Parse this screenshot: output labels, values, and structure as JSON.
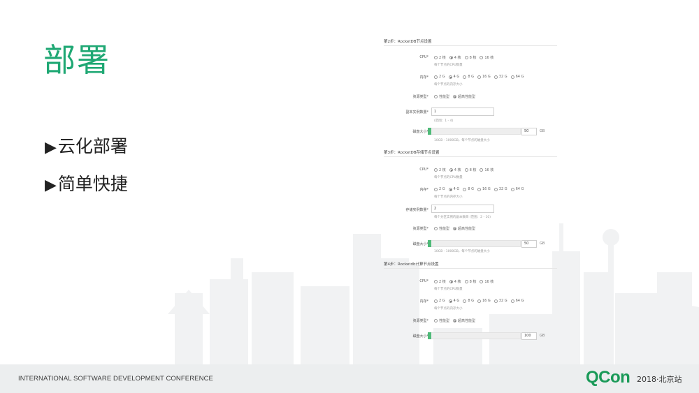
{
  "slide": {
    "title": "部署",
    "bullet_marker": "▶",
    "bullets": [
      "云化部署",
      "简单快捷"
    ]
  },
  "form": {
    "sections": [
      {
        "title": "第2步：RocketDB节点设置",
        "cpu_label": "CPU*",
        "cpu_options": [
          "2 核",
          "4 核",
          "8 核",
          "16 核"
        ],
        "cpu_selected": 1,
        "cpu_hint": "每个节点的CPU数量",
        "mem_label": "内存*",
        "mem_options": [
          "2 G",
          "4 G",
          "8 G",
          "16 G",
          "32 G",
          "64 G"
        ],
        "mem_selected": 1,
        "mem_hint": "每个节点的内存大小",
        "res_label": "资源类型*",
        "res_options": [
          "性能型",
          "超高性能型"
        ],
        "res_selected": 1,
        "replica_label": "副本实例数量*",
        "replica_value": "1",
        "replica_hint": "(范围：1 - 4)",
        "disk_label": "磁盘大小*",
        "disk_value": "50",
        "disk_fraction": 0.0,
        "disk_unit": "GB",
        "disk_hint": "10GB - 1000GB，每个节点的磁盘大小"
      },
      {
        "title": "第3步：RocketDB存储节点设置",
        "cpu_label": "CPU*",
        "cpu_options": [
          "2 核",
          "4 核",
          "8 核",
          "16 核"
        ],
        "cpu_selected": 1,
        "cpu_hint": "每个节点的CPU数量",
        "mem_label": "内存*",
        "mem_options": [
          "2 G",
          "4 G",
          "8 G",
          "16 G",
          "32 G",
          "64 G"
        ],
        "mem_selected": 1,
        "mem_hint": "每个节点的内存大小",
        "replica_label": "存储实例数量*",
        "replica_value": "2",
        "replica_hint": "每个分区实例的副本数目 (范围：2 - 10)",
        "res_label": "资源类型*",
        "res_options": [
          "性能型",
          "超高性能型"
        ],
        "res_selected": 1,
        "disk_label": "磁盘大小*",
        "disk_value": "50",
        "disk_fraction": 0.0,
        "disk_unit": "GB",
        "disk_hint": "10GB - 1000GB，每个节点的磁盘大小"
      },
      {
        "title": "第4步：Rocketdb计算节点设置",
        "cpu_label": "CPU*",
        "cpu_options": [
          "2 核",
          "4 核",
          "8 核",
          "16 核"
        ],
        "cpu_selected": 1,
        "cpu_hint": "每个节点的CPU数量",
        "mem_label": "内存*",
        "mem_options": [
          "2 G",
          "4 G",
          "8 G",
          "16 G",
          "32 G",
          "64 G"
        ],
        "mem_selected": 1,
        "mem_hint": "每个节点的内存大小",
        "res_label": "资源类型*",
        "res_options": [
          "性能型",
          "超高性能型"
        ],
        "res_selected": 1,
        "disk_label": "磁盘大小*",
        "disk_value": "100",
        "disk_fraction": 0.0,
        "disk_unit": "GB"
      }
    ]
  },
  "footer": {
    "conference": "INTERNATIONAL SOFTWARE DEVELOPMENT CONFERENCE",
    "logo": "QCon",
    "logo_sub": "2018·北京站"
  },
  "colors": {
    "accent": "#1fa874",
    "slider_fill": "#4fba78",
    "footer_bg": "#eceeef"
  }
}
